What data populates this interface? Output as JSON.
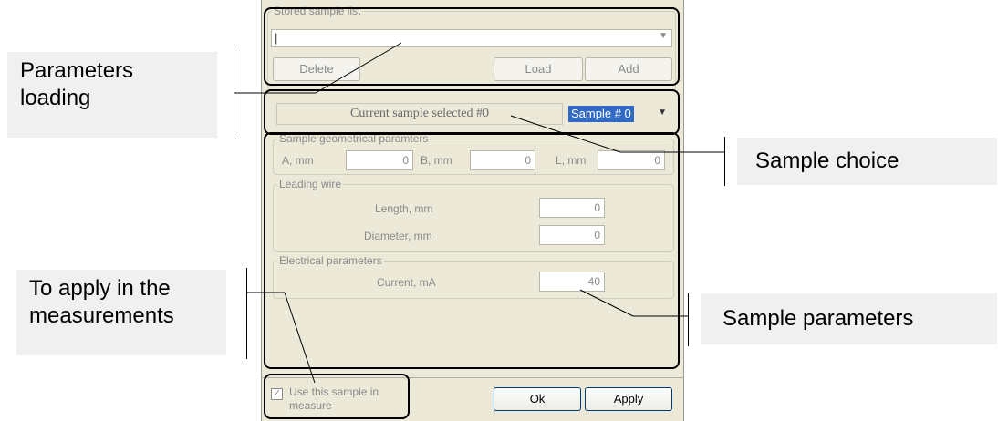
{
  "dialog": {
    "stored_list": {
      "title": "Stored sample list",
      "value": "|",
      "delete_label": "Delete",
      "load_label": "Load",
      "add_label": "Add"
    },
    "current_sample": {
      "label": "Current sample selected #0",
      "selected_option": "Sample # 0"
    },
    "geometry": {
      "title": "Sample geometrical paramters",
      "a_label": "A, mm",
      "a_value": "0",
      "b_label": "B, mm",
      "b_value": "0",
      "l_label": "L, mm",
      "l_value": "0"
    },
    "leading_wire": {
      "title": "Leading wire",
      "length_label": "Length, mm",
      "length_value": "0",
      "diameter_label": "Diameter, mm",
      "diameter_value": "0"
    },
    "electrical": {
      "title": "Electrical parameters",
      "current_label": "Current, mA",
      "current_value": "40"
    },
    "use_sample": {
      "checked": true,
      "label_line1": "Use this sample in",
      "label_line2": "measure"
    },
    "ok_label": "Ok",
    "apply_label": "Apply"
  },
  "callouts": {
    "parameters_loading": [
      "Parameters",
      "loading"
    ],
    "sample_choice": "Sample choice",
    "to_apply": [
      "To apply in the",
      "measurements"
    ],
    "sample_parameters": "Sample parameters"
  },
  "colors": {
    "dialog_bg": "#ece9d8",
    "selection": "#316ac5",
    "callout_bg": "#f0f0f0"
  }
}
